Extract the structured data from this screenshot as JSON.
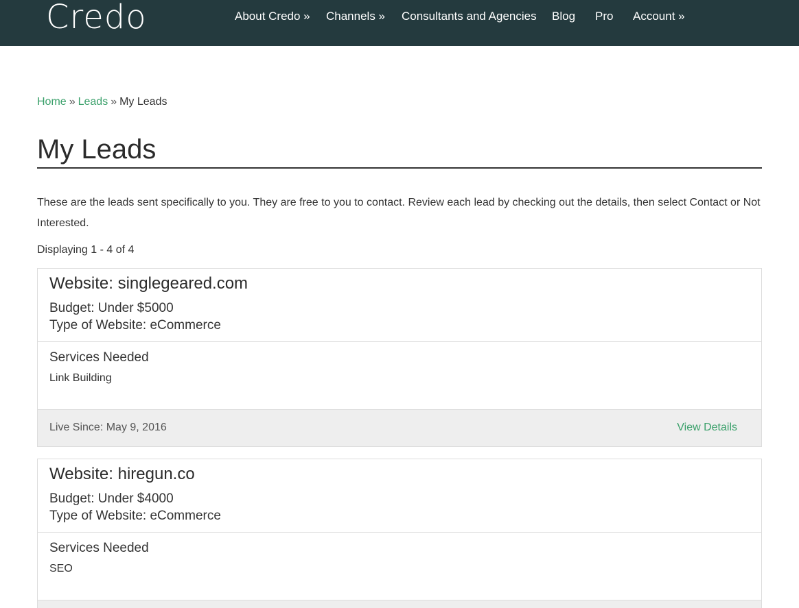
{
  "header": {
    "logo": "Credo",
    "nav": [
      "About Credo »",
      "Channels »",
      "Consultants and Agencies",
      "Blog",
      "Pro",
      "Account »"
    ]
  },
  "breadcrumb": {
    "home": "Home",
    "sep": "»",
    "leads": "Leads",
    "current": "My Leads"
  },
  "page": {
    "title": "My Leads",
    "intro": "These are the leads sent specifically to you. They are free to you to contact. Review each lead by checking out the details, then select Contact or Not Interested.",
    "count": "Displaying 1 - 4 of 4"
  },
  "leads": [
    {
      "website": "Website:  singlegeared.com",
      "budget": "Budget:  Under $5000",
      "type": "Type of Website:  eCommerce",
      "services_title": "Services Needed",
      "services": "Link Building",
      "live_since": "Live Since:  May 9, 2016",
      "details_label": "View Details"
    },
    {
      "website": "Website:  hiregun.co",
      "budget": "Budget:  Under $4000",
      "type": "Type of Website:  eCommerce",
      "services_title": "Services Needed",
      "services": "SEO"
    }
  ]
}
